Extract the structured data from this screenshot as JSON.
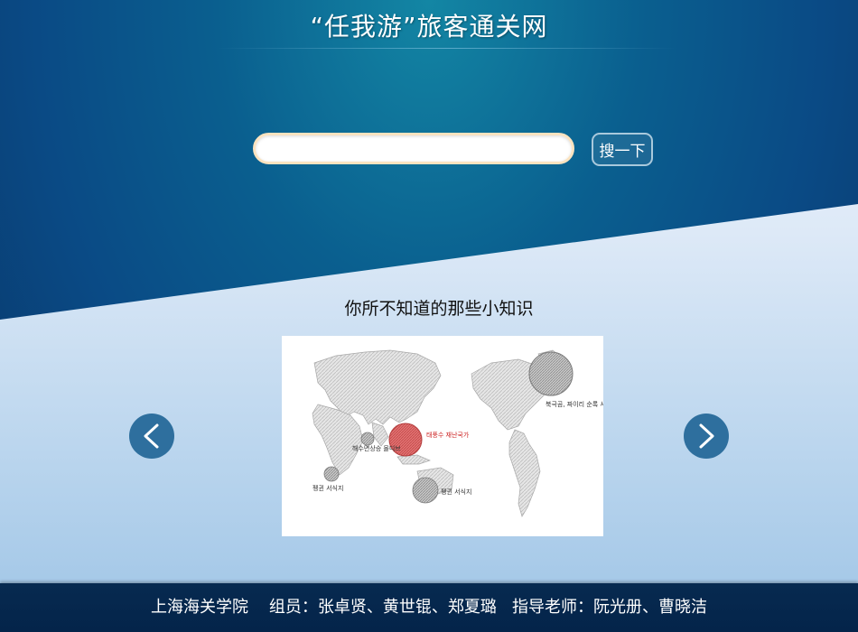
{
  "header": {
    "title": "“任我游”旅客通关网"
  },
  "search": {
    "value": "",
    "placeholder": "",
    "button_label": "搜一下"
  },
  "knowledge": {
    "heading": "你所不知道的那些小知识",
    "image_labels": {
      "highlight": "태풍수 재난국가",
      "north": "북극곰, 짜이리 순록 서식지",
      "coral": "해수면상승 몰디브",
      "south_west": "펭귄 서식지",
      "south_east": "펭귄 서식지"
    }
  },
  "colors": {
    "accent_highlight": "#e05a5a",
    "arrow_bg": "#2e6f9e",
    "footer_bg": "#04244a"
  },
  "footer": {
    "school": "上海海关学院",
    "members": "组员：张卓贤、黄世锟、郑夏璐",
    "advisors": "指导老师：阮光册、曹晓洁"
  }
}
